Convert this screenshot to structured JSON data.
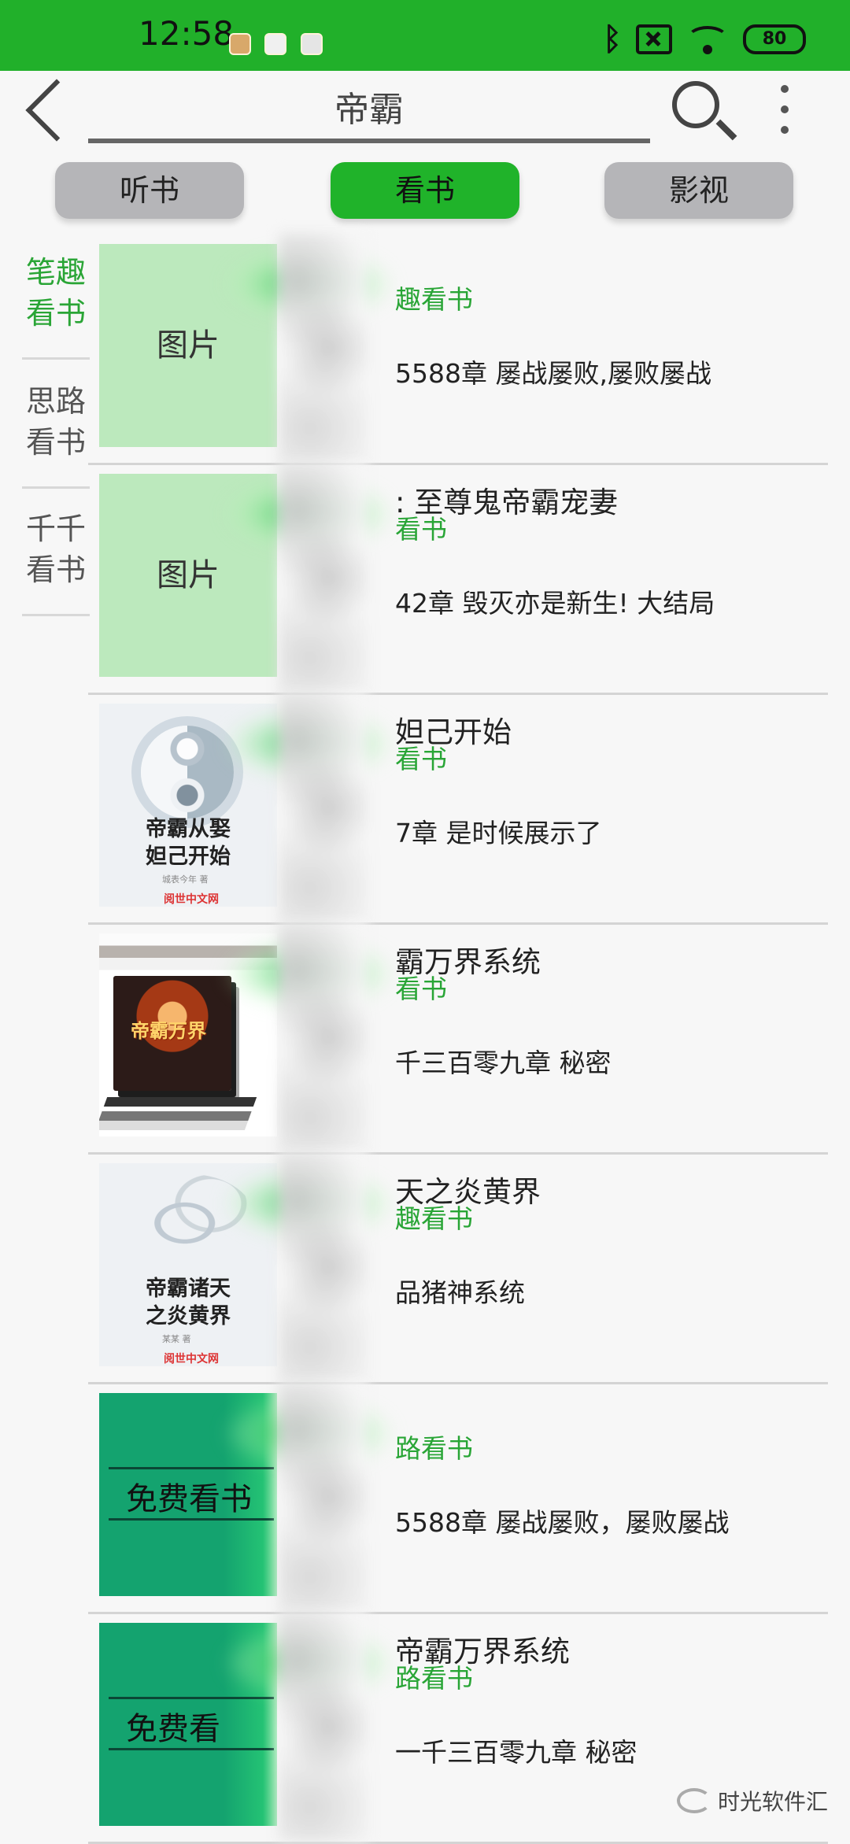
{
  "status_bar": {
    "time": "12:58",
    "battery": "80",
    "icons": [
      "app-icon",
      "app-icon",
      "app-icon",
      "bluetooth-icon",
      "no-sim-icon",
      "wifi-icon",
      "battery-icon"
    ]
  },
  "header": {
    "query": "帝霸",
    "icons": [
      "back-icon",
      "search-icon",
      "more-vertical-icon"
    ]
  },
  "tabs": [
    "听书",
    "看书",
    "影视"
  ],
  "active_tab": "看书",
  "sources": [
    {
      "label": "笔趣\n看书",
      "active": true
    },
    {
      "label": "思路\n看书",
      "active": false
    },
    {
      "label": "千千\n看书",
      "active": false
    }
  ],
  "results": [
    {
      "cover_type": "placeholder",
      "cover_text": "图片",
      "title": "",
      "source": "趣看书",
      "latest": "5588章 屡战屡败,屡败屡战"
    },
    {
      "cover_type": "placeholder",
      "cover_text": "图片",
      "title": ": 至尊鬼帝霸宠妻",
      "source": "看书",
      "latest": "42章 毁灭亦是新生! 大结局"
    },
    {
      "cover_type": "taichi",
      "cover_title": "帝霸从娶\n妲己开始",
      "cover_author": "城表今年 著",
      "cover_logo": "阅世中文网",
      "title": "妲己开始",
      "source": "看书",
      "latest": "7章 是时候展示了"
    },
    {
      "cover_type": "epic",
      "cover_title": "帝霸万界",
      "title": "霸万界系统",
      "source": "看书",
      "latest": "千三百零九章 秘密"
    },
    {
      "cover_type": "dragon",
      "cover_title": "帝霸诸天\n之炎黄界",
      "cover_author": "某某 著",
      "cover_logo": "阅世中文网",
      "title": "天之炎黄界",
      "source": "趣看书",
      "latest": "品猪神系统"
    },
    {
      "cover_type": "free",
      "cover_text": "免费看书",
      "title": "",
      "source": "路看书",
      "latest": "5588章 屡战屡败，屡败屡战"
    },
    {
      "cover_type": "free",
      "cover_text": "免费看",
      "title": "帝霸万界系统",
      "source": "路看书",
      "latest": "一千三百零九章 秘密"
    }
  ],
  "watermark": "时光软件汇",
  "colors": {
    "status_green": "#21b02a",
    "accent_green": "#2aa536",
    "tab_gray": "#b5b5b8",
    "background": "#f7f7f7"
  }
}
